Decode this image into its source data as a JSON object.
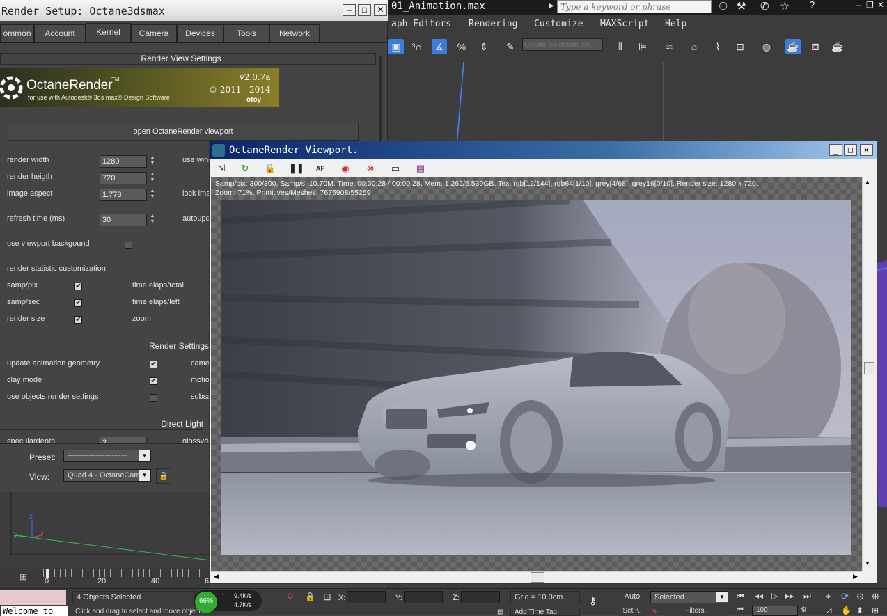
{
  "max": {
    "title": "01_Animation.max",
    "search_placeholder": "Type a keyword or phrase",
    "menu": [
      "aph Editors",
      "Rendering",
      "Customize",
      "MAXScript",
      "Help"
    ],
    "selection_set_placeholder": "Create Selection Se"
  },
  "render_setup": {
    "title": "Render Setup: Octane3dsmax",
    "tabs": [
      "ommon",
      "Account",
      "Kernel",
      "Camera",
      "Devices",
      "Tools",
      "Network"
    ],
    "section_view": "Render View Settings",
    "banner": {
      "name": "OctaneRender",
      "tm": "TM",
      "tagline": "for use with Autodesk® 3ds max® Design Software",
      "version": "v2.0.7a",
      "copyright": "© 2011 - 2014",
      "brand": "otoy"
    },
    "open_button": "open OctaneRender viewport",
    "render_width_label": "render width",
    "render_width": "1280",
    "render_height_label": "render heigth",
    "render_height": "720",
    "image_aspect_label": "image aspect",
    "image_aspect": "1.778",
    "refresh_label": "refresh time (ms)",
    "refresh": "30",
    "use_win_label": "use wind",
    "lock_ima_label": "lock ima",
    "autoupd_label": "autoupd",
    "use_viewport_bg_label": "use viewport backgound",
    "stat_custom_label": "render statistic customization",
    "samp_pix": "samp/pix",
    "samp_sec": "samp/sec",
    "render_size": "render size",
    "time_total": "time elaps/total",
    "time_left": "time elaps/left",
    "zoom": "zoom",
    "section_render": "Render Settings",
    "update_anim": "update animation geometry",
    "clay_mode": "clay mode",
    "use_obj": "use objects render settings",
    "came": "came",
    "motio": "motio",
    "subsa": "subsa",
    "section_direct": "Direct Light",
    "specdepth": "speculardepth",
    "specdepth_val": "2",
    "glossyde": "glossyde",
    "preset_label": "Preset:",
    "preset_value": "--------------------------",
    "view_label": "View:",
    "view_value": "Quad 4 - OctaneCame"
  },
  "viewport": {
    "title": "OctaneRender Viewport.",
    "stats1": "Samp/pix: 300/300.   Samp/s: 10.70M.   Time: 00:00:28 / 00:00:28.   Mem: 1.262/5.539GB.   Tex: rgb[12/144], rgb64[1/10], grey[4/68], grey16[0/10].   Render size: 1280 x 720.",
    "stats2": "Zoom: 71%.   Primitives/Meshes: 7675908/55259"
  },
  "timeline": {
    "ticks": [
      "0",
      "20",
      "40",
      "6"
    ]
  },
  "status": {
    "welcome": "Welcome to",
    "objects": "4 Objects Selected",
    "prompt": "Click and drag to select and move objects",
    "net_pct": "66%",
    "up": "9.4K/s",
    "down": "4.7K/s",
    "x": "X:",
    "y": "Y:",
    "z": "Z:",
    "grid": "Grid = 10.0cm",
    "auto": "Auto",
    "selected": "Selected",
    "setk": "Set K.",
    "filters": "Filters...",
    "add_time_tag": "Add Time Tag",
    "frame": "100"
  },
  "colors": {
    "accent": "#3b7dd8",
    "title_grad": "#0a246a"
  }
}
